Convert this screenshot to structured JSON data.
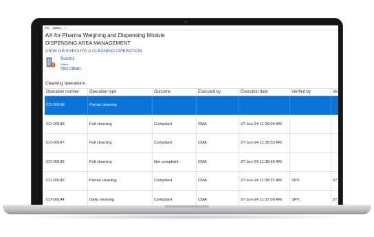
{
  "menu": [
    "File",
    "Utilities",
    "?"
  ],
  "app_title": "AX for Pharma Weighing and Dispensing Module",
  "app_subtitle": "DISPENSING AREA MANAGEMENT",
  "action_link": "VIEW OR EXECUTE A CLEANING OPERATION",
  "booth": {
    "name": "Booth1",
    "status_label": "Status",
    "status_value": "Not clean",
    "icon": "booth-warning-icon"
  },
  "section_title": "Cleaning operations",
  "table": {
    "columns": [
      "Operation number",
      "Operation type",
      "Outcome",
      "Executed by",
      "Execution date",
      "Verified by",
      "Ve"
    ],
    "rows": [
      {
        "number": "CO-00149",
        "type": "Partial cleaning",
        "outcome": "",
        "executed_by": "",
        "date": "",
        "verified_by": "",
        "extra": ""
      },
      {
        "number": "CO-00148",
        "type": "Full cleaning",
        "outcome": "Compliant",
        "executed_by": "CMA",
        "date": "27-Jun-24 11:39:04 AM",
        "verified_by": "",
        "extra": ""
      },
      {
        "number": "CO-00147",
        "type": "Full cleaning",
        "outcome": "Compliant",
        "executed_by": "CMA",
        "date": "27-Jun-24 11:38:53 AM",
        "verified_by": "",
        "extra": ""
      },
      {
        "number": "CO-00146",
        "type": "Full cleaning",
        "outcome": "Not compliant",
        "executed_by": "CMA",
        "date": "27-Jun-24 11:38:45 AM",
        "verified_by": "",
        "extra": ""
      },
      {
        "number": "CO-00145",
        "type": "Partial cleaning",
        "outcome": "Compliant",
        "executed_by": "CMA",
        "date": "27-Jun-24 11:38:31 AM",
        "verified_by": "SPV",
        "extra": "27"
      },
      {
        "number": "CO-00144",
        "type": "Daily cleaning",
        "outcome": "Compliant",
        "executed_by": "CMA",
        "date": "27-Jun-24 11:37:00 AM",
        "verified_by": "SPV",
        "extra": "27"
      }
    ],
    "selected_row_index": 0
  },
  "colors": {
    "accent_link": "#2b5bb5",
    "selection": "#0a74d8",
    "warning": "#e0531f"
  }
}
